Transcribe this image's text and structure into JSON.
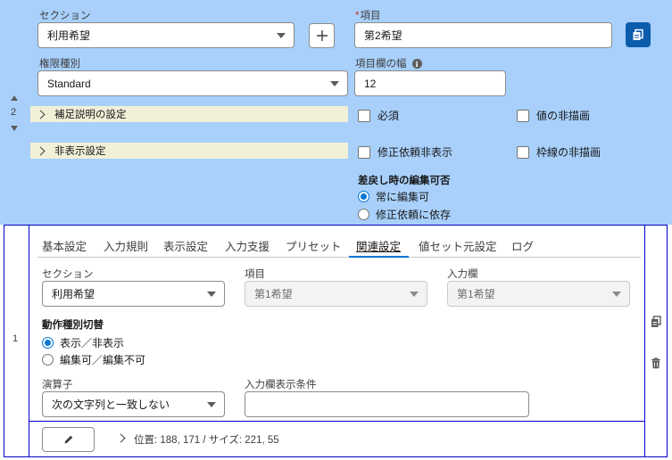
{
  "top": {
    "section_label": "セクション",
    "section_value": "利用希望",
    "item_label": "項目",
    "item_required": "*",
    "item_value": "第2希望",
    "perm_label": "権限種別",
    "perm_value": "Standard",
    "width_label": "項目欄の幅",
    "width_value": "12",
    "row_number": "2",
    "acc_supplement": "補足説明の設定",
    "acc_hidden": "非表示設定",
    "cb_required": "必須",
    "cb_hide_value": "値の非描画",
    "cb_hide_on_fix": "修正依頼非表示",
    "cb_hide_border": "枠線の非描画",
    "remand_title": "差戻し時の編集可否",
    "radio_always": "常に編集可",
    "radio_depends": "修正依頼に依存"
  },
  "bottom": {
    "row_number": "1",
    "tabs": [
      "基本設定",
      "入力規則",
      "表示設定",
      "入力支援",
      "プリセット",
      "関連設定",
      "値セット元設定",
      "ログ"
    ],
    "active_tab_index": 5,
    "section_label": "セクション",
    "section_value": "利用希望",
    "item_label": "項目",
    "item_value": "第1希望",
    "input_label": "入力欄",
    "input_value": "第1希望",
    "action_title": "動作種別切替",
    "radio_show": "表示／非表示",
    "radio_edit": "編集可／編集不可",
    "operator_label": "演算子",
    "operator_value": "次の文字列と一致しない",
    "condition_label": "入力欄表示条件",
    "condition_value": "",
    "footer_info": "位置: 188, 171 / サイズ: 221, 55"
  },
  "colors": {
    "top_bg": "#a8d0fb",
    "brand": "#0b5cab",
    "accent": "#0176d3",
    "frame": "#0000c8",
    "accordion_bg": "#f3f0d8"
  },
  "icons": [
    "plus-icon",
    "copy-icon",
    "info-icon",
    "arrow-up-icon",
    "arrow-down-icon",
    "chevron-right-icon",
    "pencil-icon",
    "trash-icon"
  ]
}
